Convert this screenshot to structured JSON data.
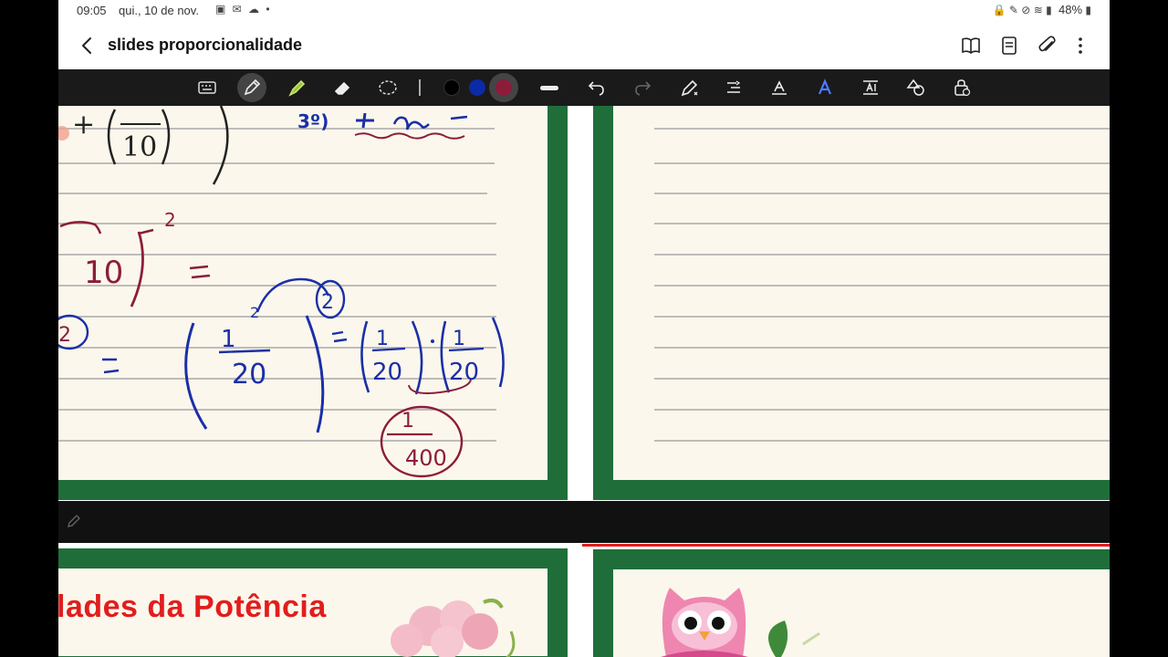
{
  "status_bar": {
    "time": "09:05",
    "date": "qui., 10 de nov.",
    "battery": "48%"
  },
  "title_bar": {
    "back_icon": "chevron-left-icon",
    "title": "slides proporcionalidade",
    "icons": [
      "book-icon",
      "document-icon",
      "paperclip-icon",
      "more-vertical-icon"
    ]
  },
  "pen_toolbar": {
    "tools": [
      "keyboard-icon",
      "pen-icon",
      "highlighter-icon",
      "eraser-icon",
      "lasso-icon"
    ],
    "colors": [
      "#000000",
      "#0a2aa8",
      "#8b1d3a"
    ],
    "actions": [
      "stroke-width-icon",
      "undo-icon",
      "redo-icon",
      "pen-settings-icon",
      "text-align-icon",
      "handwriting-icon",
      "text-style-icon",
      "text-box-icon",
      "shapes-icon",
      "lock-icon"
    ],
    "colors_accent": {
      "active_tool_bg": "#444444"
    }
  },
  "slides": {
    "bottom_title": "lades da Potência"
  },
  "handwriting": {
    "ten": "10",
    "one": "1",
    "twenty": "20",
    "four_hundred": "400",
    "two": "2",
    "three_label": "3º)",
    "plus": "+",
    "exp": "-2"
  }
}
